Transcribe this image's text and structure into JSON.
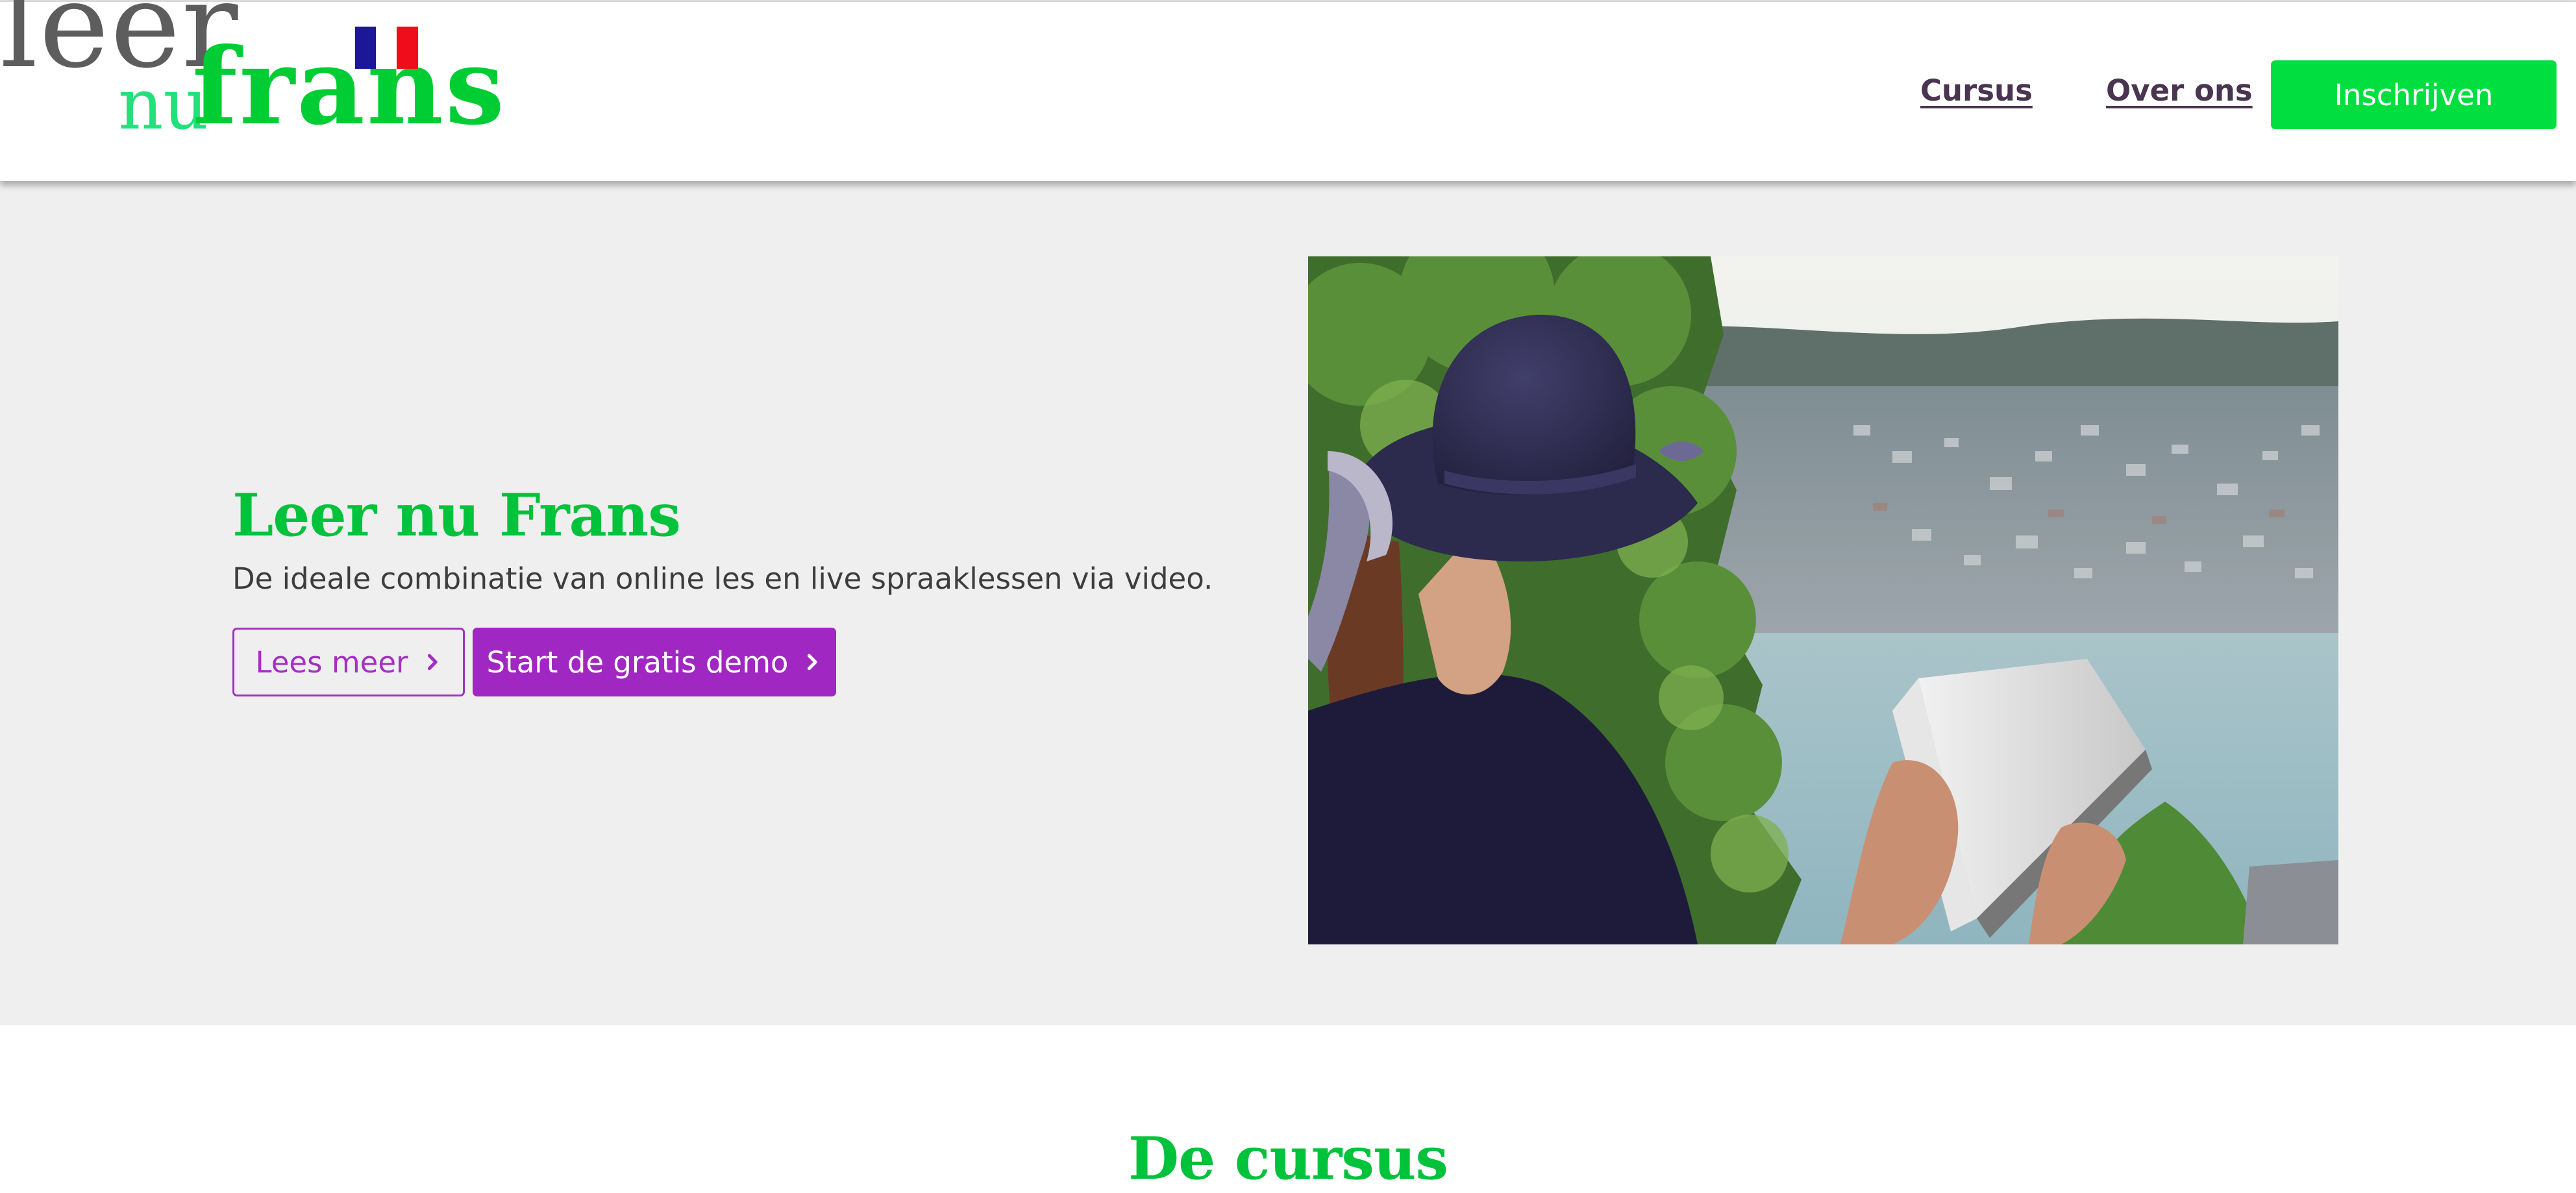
{
  "header": {
    "logo": {
      "word_leer": "leer",
      "word_nu": "nu",
      "word_frans": "frans"
    },
    "nav": [
      {
        "label": "Cursus"
      },
      {
        "label": "Over ons"
      }
    ],
    "signup_label": "Inschrijven",
    "colors": {
      "accent_green": "#00df3f",
      "nav_text": "#4a3550"
    }
  },
  "hero": {
    "title": "Leer nu Frans",
    "subtitle": "De ideale combinatie van online les en live spraaklessen via video.",
    "buttons": {
      "read_more": "Lees meer",
      "demo": "Start de gratis demo"
    },
    "image": {
      "icon": "woman-reading-book-photo"
    },
    "colors": {
      "title": "#00c23b",
      "purple": "#a127c2",
      "background": "#efefef"
    }
  },
  "course_section": {
    "title": "De cursus"
  }
}
